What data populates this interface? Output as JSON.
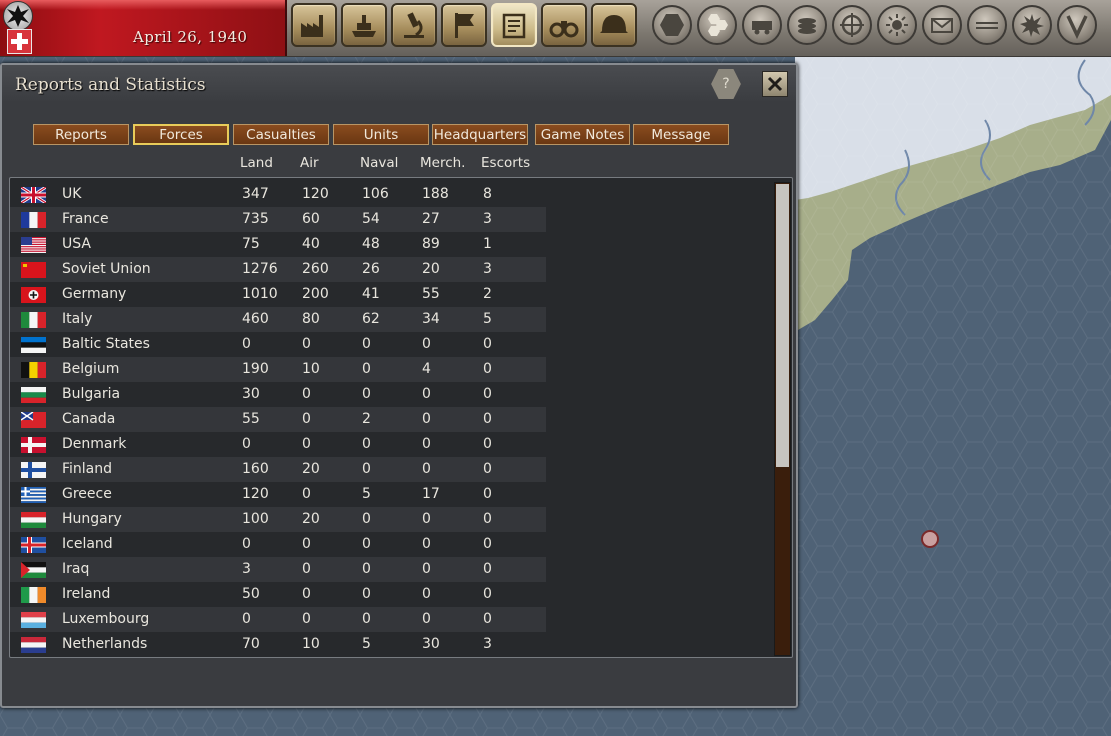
{
  "topbar": {
    "date": "April 26, 1940"
  },
  "dialog": {
    "title": "Reports and Statistics",
    "help_label": "?"
  },
  "tabs": [
    {
      "label": "Reports",
      "active": false
    },
    {
      "label": "Forces",
      "active": true
    },
    {
      "label": "Casualties",
      "active": false
    },
    {
      "label": "Units",
      "active": false
    },
    {
      "label": "Headquarters",
      "active": false
    },
    {
      "label": "Game Notes",
      "active": false
    },
    {
      "label": "Message",
      "active": false
    }
  ],
  "table": {
    "columns": [
      "Land",
      "Air",
      "Naval",
      "Merch.",
      "Escorts"
    ],
    "rows": [
      {
        "flag": "uk",
        "name": "UK",
        "land": "347",
        "air": "120",
        "naval": "106",
        "merch": "188",
        "escorts": "8"
      },
      {
        "flag": "france",
        "name": "France",
        "land": "735",
        "air": "60",
        "naval": "54",
        "merch": "27",
        "escorts": "3"
      },
      {
        "flag": "usa",
        "name": "USA",
        "land": "75",
        "air": "40",
        "naval": "48",
        "merch": "89",
        "escorts": "1"
      },
      {
        "flag": "soviet",
        "name": "Soviet Union",
        "land": "1276",
        "air": "260",
        "naval": "26",
        "merch": "20",
        "escorts": "3"
      },
      {
        "flag": "germany",
        "name": "Germany",
        "land": "1010",
        "air": "200",
        "naval": "41",
        "merch": "55",
        "escorts": "2"
      },
      {
        "flag": "italy",
        "name": "Italy",
        "land": "460",
        "air": "80",
        "naval": "62",
        "merch": "34",
        "escorts": "5"
      },
      {
        "flag": "baltic",
        "name": "Baltic States",
        "land": "0",
        "air": "0",
        "naval": "0",
        "merch": "0",
        "escorts": "0"
      },
      {
        "flag": "belgium",
        "name": "Belgium",
        "land": "190",
        "air": "10",
        "naval": "0",
        "merch": "4",
        "escorts": "0"
      },
      {
        "flag": "bulgaria",
        "name": "Bulgaria",
        "land": "30",
        "air": "0",
        "naval": "0",
        "merch": "0",
        "escorts": "0"
      },
      {
        "flag": "canada",
        "name": "Canada",
        "land": "55",
        "air": "0",
        "naval": "2",
        "merch": "0",
        "escorts": "0"
      },
      {
        "flag": "denmark",
        "name": "Denmark",
        "land": "0",
        "air": "0",
        "naval": "0",
        "merch": "0",
        "escorts": "0"
      },
      {
        "flag": "finland",
        "name": "Finland",
        "land": "160",
        "air": "20",
        "naval": "0",
        "merch": "0",
        "escorts": "0"
      },
      {
        "flag": "greece",
        "name": "Greece",
        "land": "120",
        "air": "0",
        "naval": "5",
        "merch": "17",
        "escorts": "0"
      },
      {
        "flag": "hungary",
        "name": "Hungary",
        "land": "100",
        "air": "20",
        "naval": "0",
        "merch": "0",
        "escorts": "0"
      },
      {
        "flag": "iceland",
        "name": "Iceland",
        "land": "0",
        "air": "0",
        "naval": "0",
        "merch": "0",
        "escorts": "0"
      },
      {
        "flag": "iraq",
        "name": "Iraq",
        "land": "3",
        "air": "0",
        "naval": "0",
        "merch": "0",
        "escorts": "0"
      },
      {
        "flag": "ireland",
        "name": "Ireland",
        "land": "50",
        "air": "0",
        "naval": "0",
        "merch": "0",
        "escorts": "0"
      },
      {
        "flag": "luxembourg",
        "name": "Luxembourg",
        "land": "0",
        "air": "0",
        "naval": "0",
        "merch": "0",
        "escorts": "0"
      },
      {
        "flag": "netherlands",
        "name": "Netherlands",
        "land": "70",
        "air": "10",
        "naval": "5",
        "merch": "30",
        "escorts": "3"
      }
    ]
  },
  "scroll": {
    "position": 0.0,
    "visible_fraction": 0.6
  },
  "colors": {
    "tab_bg": "#7a4117",
    "tab_active_border": "#e8cc5a",
    "date_strip": "#b0141b",
    "sea": "#4f6276",
    "land": "#a7ae8a"
  }
}
